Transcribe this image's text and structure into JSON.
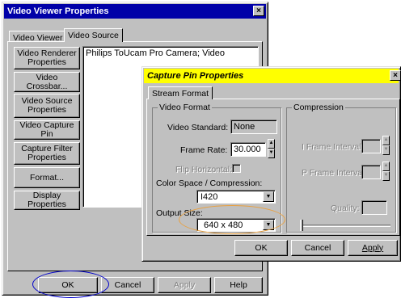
{
  "video_viewer": {
    "title": "Video Viewer Properties",
    "tabs": [
      {
        "label": "Video Viewer"
      },
      {
        "label": "Video Source"
      }
    ],
    "side_buttons": [
      "Video Renderer Properties",
      "Video Crossbar...",
      "Video Source Properties",
      "Video Capture Pin",
      "Capture Filter Properties",
      "Format...",
      "Display Properties"
    ],
    "source_list": [
      "Philips ToUcam Pro Camera; Video"
    ],
    "footer": {
      "ok": "OK",
      "cancel": "Cancel",
      "apply": "Apply",
      "help": "Help"
    }
  },
  "capture_pin": {
    "title": "Capture Pin Properties",
    "tab": "Stream Format",
    "video_format": {
      "group_label": "Video Format",
      "standard_label": "Video Standard:",
      "standard_value": "None",
      "frame_rate_label": "Frame Rate:",
      "frame_rate_value": "30.000",
      "flip_label": "Flip Horizontal:",
      "color_space_label": "Color Space / Compression:",
      "color_space_value": "I420",
      "output_size_label": "Output Size:",
      "output_size_value": "640 x 480"
    },
    "compression": {
      "group_label": "Compression",
      "iframe_label": "I Frame Interval:",
      "pframe_label": "P Frame Interval:",
      "quality_label": "Quality:"
    },
    "footer": {
      "ok": "OK",
      "cancel": "Cancel",
      "apply": "Apply"
    }
  },
  "highlights": {
    "ok_circle_color": "#0000cc",
    "output_size_circle_color": "#e8a040"
  }
}
